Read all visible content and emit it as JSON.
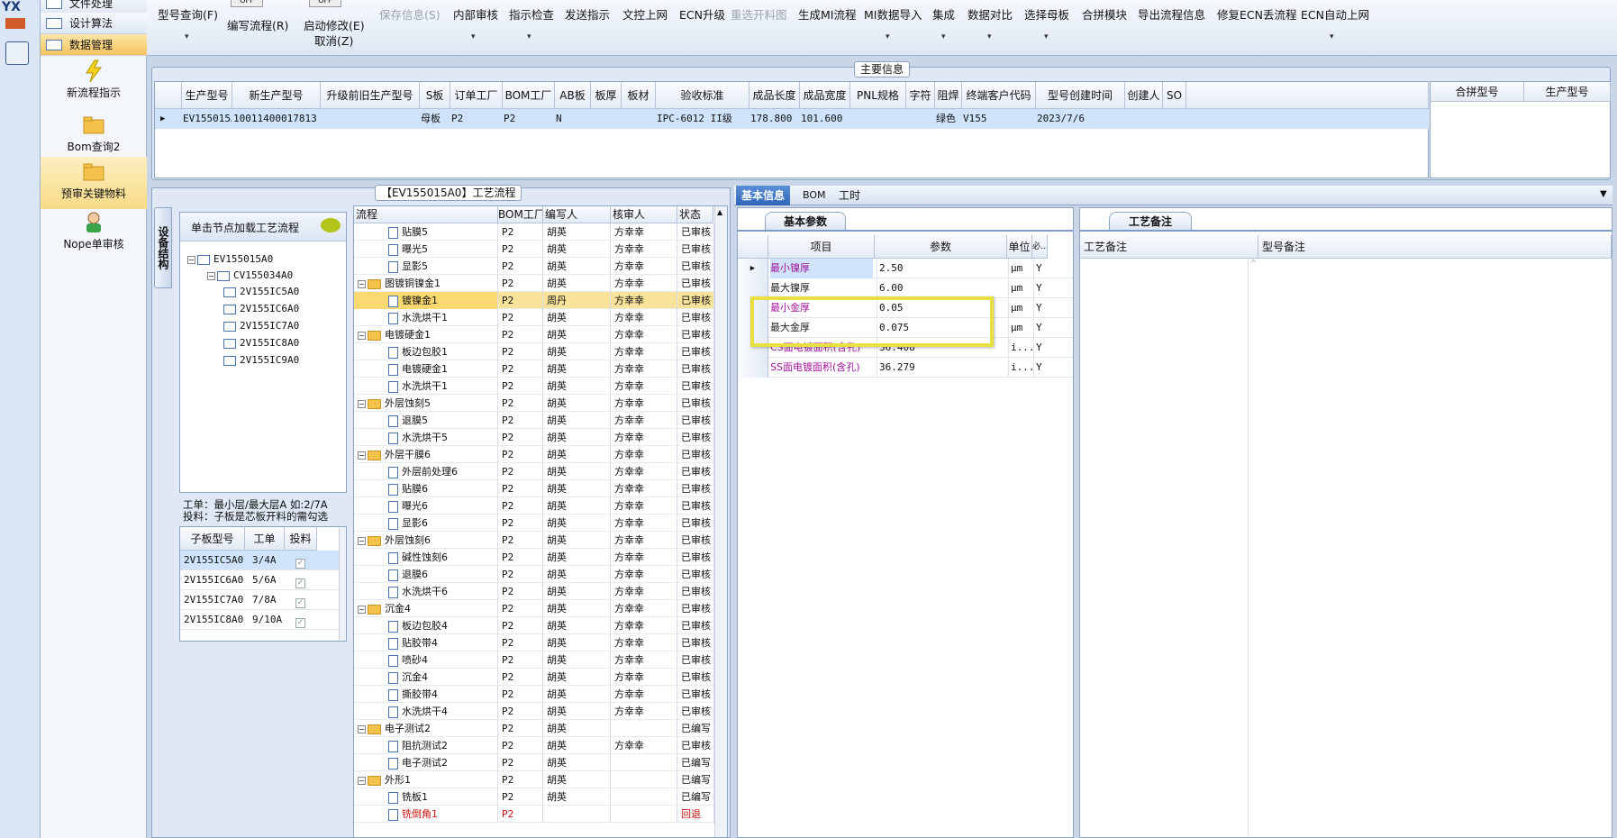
{
  "app": {
    "logo_text": "YX"
  },
  "nav": {
    "rows": [
      {
        "label": "文件处理"
      },
      {
        "label": "设计算法"
      },
      {
        "label": "数据管理"
      }
    ],
    "buttons": [
      {
        "label": "新流程指示",
        "icon": "lightning-icon"
      },
      {
        "label": "Bom查询2",
        "icon": "folder-icon"
      },
      {
        "label": "预审关键物料",
        "icon": "folder-icon"
      },
      {
        "label": "Nope单审核",
        "icon": "user-icon"
      }
    ]
  },
  "toolbar": {
    "items": [
      {
        "label": "型号查询(F)",
        "disabled": false
      },
      {
        "label": "编写流程(R)",
        "disabled": false
      },
      {
        "label": "启动修改(E)",
        "disabled": false
      },
      {
        "label": "取消(Z)",
        "disabled": false
      },
      {
        "label": "保存信息(S)",
        "disabled": true
      },
      {
        "label": "内部审核",
        "disabled": false
      },
      {
        "label": "指示检查",
        "disabled": false
      },
      {
        "label": "发送指示",
        "disabled": false
      },
      {
        "label": "文控上网",
        "disabled": false
      },
      {
        "label": "ECN升级",
        "disabled": false
      },
      {
        "label": "重选开料图",
        "disabled": true
      },
      {
        "label": "生成MI流程",
        "disabled": false
      },
      {
        "label": "MI数据导入",
        "disabled": false
      },
      {
        "label": "集成",
        "disabled": false
      },
      {
        "label": "数据对比",
        "disabled": false
      },
      {
        "label": "选择母板",
        "disabled": false
      },
      {
        "label": "合拼模块",
        "disabled": false
      },
      {
        "label": "导出流程信息",
        "disabled": false
      },
      {
        "label": "修复ECN丢流程",
        "disabled": false
      },
      {
        "label": "ECN自动上网",
        "disabled": false
      }
    ],
    "toggle_off": "OFF"
  },
  "main_info": {
    "title": "主要信息",
    "columns": [
      "生产型号",
      "新生产型号",
      "升级前旧生产型号",
      "S板",
      "订单工厂",
      "BOM工厂",
      "AB板",
      "板厚",
      "板材",
      "验收标准",
      "成品长度",
      "成品宽度",
      "PNL规格",
      "字符",
      "阻焊",
      "终端客户代码",
      "型号创建时间",
      "创建人",
      "SO"
    ],
    "row": [
      "EV155015A0",
      "10011400017813",
      "",
      "母板",
      "P2",
      "P2",
      "N",
      "",
      "",
      "IPC-6012 II级",
      "178.800",
      "101.600",
      "",
      "",
      "绿色",
      "V155",
      "2023/7/6",
      "",
      ""
    ],
    "side_columns": [
      "合拼型号",
      "生产型号"
    ]
  },
  "process": {
    "title": "【EV155015A0】工艺流程",
    "left_tab": "设备结构",
    "hint": "单击节点加载工艺流程",
    "tree": [
      "EV155015A0",
      "CV155034A0",
      "2V155IC5A0",
      "2V155IC6A0",
      "2V155IC7A0",
      "2V155IC8A0",
      "2V155IC9A0"
    ],
    "notes": [
      "工单：最小层/最大层A 如:2/7A",
      "投料：子板是芯板开料的需勾选"
    ],
    "sub_columns": [
      "子板型号",
      "工单",
      "投料"
    ],
    "sub_rows": [
      [
        "2V155IC5A0",
        "3/4A"
      ],
      [
        "2V155IC6A0",
        "5/6A"
      ],
      [
        "2V155IC7A0",
        "7/8A"
      ],
      [
        "2V155IC8A0",
        "9/10A"
      ]
    ],
    "flow_columns": [
      "流程",
      "BOM工厂",
      "编写人",
      "核审人",
      "状态"
    ],
    "flow_rows": [
      {
        "name": "贴膜5",
        "lvl": 2,
        "f": "P2",
        "w": "胡英",
        "r": "方幸幸",
        "s": "已审核"
      },
      {
        "name": "曝光5",
        "lvl": 2,
        "f": "P2",
        "w": "胡英",
        "r": "方幸幸",
        "s": "已审核"
      },
      {
        "name": "显影5",
        "lvl": 2,
        "f": "P2",
        "w": "胡英",
        "r": "方幸幸",
        "s": "已审核"
      },
      {
        "name": "图镀铜镍金1",
        "lvl": 1,
        "f": "P2",
        "w": "胡英",
        "r": "方幸幸",
        "s": "已审核"
      },
      {
        "name": "镀镍金1",
        "lvl": 2,
        "f": "P2",
        "w": "周丹",
        "r": "方幸幸",
        "s": "已审核",
        "sel": true
      },
      {
        "name": "水洗烘干1",
        "lvl": 2,
        "f": "P2",
        "w": "胡英",
        "r": "方幸幸",
        "s": "已审核"
      },
      {
        "name": "电镀硬金1",
        "lvl": 1,
        "f": "P2",
        "w": "胡英",
        "r": "方幸幸",
        "s": "已审核"
      },
      {
        "name": "板边包胶1",
        "lvl": 2,
        "f": "P2",
        "w": "胡英",
        "r": "方幸幸",
        "s": "已审核"
      },
      {
        "name": "电镀硬金1",
        "lvl": 2,
        "f": "P2",
        "w": "胡英",
        "r": "方幸幸",
        "s": "已审核"
      },
      {
        "name": "水洗烘干1",
        "lvl": 2,
        "f": "P2",
        "w": "胡英",
        "r": "方幸幸",
        "s": "已审核"
      },
      {
        "name": "外层蚀刻5",
        "lvl": 1,
        "f": "P2",
        "w": "胡英",
        "r": "方幸幸",
        "s": "已审核"
      },
      {
        "name": "退膜5",
        "lvl": 2,
        "f": "P2",
        "w": "胡英",
        "r": "方幸幸",
        "s": "已审核"
      },
      {
        "name": "水洗烘干5",
        "lvl": 2,
        "f": "P2",
        "w": "胡英",
        "r": "方幸幸",
        "s": "已审核"
      },
      {
        "name": "外层干膜6",
        "lvl": 1,
        "f": "P2",
        "w": "胡英",
        "r": "方幸幸",
        "s": "已审核"
      },
      {
        "name": "外层前处理6",
        "lvl": 2,
        "f": "P2",
        "w": "胡英",
        "r": "方幸幸",
        "s": "已审核"
      },
      {
        "name": "贴膜6",
        "lvl": 2,
        "f": "P2",
        "w": "胡英",
        "r": "方幸幸",
        "s": "已审核"
      },
      {
        "name": "曝光6",
        "lvl": 2,
        "f": "P2",
        "w": "胡英",
        "r": "方幸幸",
        "s": "已审核"
      },
      {
        "name": "显影6",
        "lvl": 2,
        "f": "P2",
        "w": "胡英",
        "r": "方幸幸",
        "s": "已审核"
      },
      {
        "name": "外层蚀刻6",
        "lvl": 1,
        "f": "P2",
        "w": "胡英",
        "r": "方幸幸",
        "s": "已审核"
      },
      {
        "name": "碱性蚀刻6",
        "lvl": 2,
        "f": "P2",
        "w": "胡英",
        "r": "方幸幸",
        "s": "已审核"
      },
      {
        "name": "退膜6",
        "lvl": 2,
        "f": "P2",
        "w": "胡英",
        "r": "方幸幸",
        "s": "已审核"
      },
      {
        "name": "水洗烘干6",
        "lvl": 2,
        "f": "P2",
        "w": "胡英",
        "r": "方幸幸",
        "s": "已审核"
      },
      {
        "name": "沉金4",
        "lvl": 1,
        "f": "P2",
        "w": "胡英",
        "r": "方幸幸",
        "s": "已审核"
      },
      {
        "name": "板边包胶4",
        "lvl": 2,
        "f": "P2",
        "w": "胡英",
        "r": "方幸幸",
        "s": "已审核"
      },
      {
        "name": "贴胶带4",
        "lvl": 2,
        "f": "P2",
        "w": "胡英",
        "r": "方幸幸",
        "s": "已审核"
      },
      {
        "name": "喷砂4",
        "lvl": 2,
        "f": "P2",
        "w": "胡英",
        "r": "方幸幸",
        "s": "已审核"
      },
      {
        "name": "沉金4",
        "lvl": 2,
        "f": "P2",
        "w": "胡英",
        "r": "方幸幸",
        "s": "已审核"
      },
      {
        "name": "撕胶带4",
        "lvl": 2,
        "f": "P2",
        "w": "胡英",
        "r": "方幸幸",
        "s": "已审核"
      },
      {
        "name": "水洗烘干4",
        "lvl": 2,
        "f": "P2",
        "w": "胡英",
        "r": "方幸幸",
        "s": "已审核"
      },
      {
        "name": "电子测试2",
        "lvl": 1,
        "f": "P2",
        "w": "胡英",
        "r": "",
        "s": "已编写"
      },
      {
        "name": "阻抗测试2",
        "lvl": 2,
        "f": "P2",
        "w": "胡英",
        "r": "方幸幸",
        "s": "已审核"
      },
      {
        "name": "电子测试2",
        "lvl": 2,
        "f": "P2",
        "w": "胡英",
        "r": "",
        "s": "已编写"
      },
      {
        "name": "外形1",
        "lvl": 1,
        "f": "P2",
        "w": "胡英",
        "r": "",
        "s": "已编写"
      },
      {
        "name": "铣板1",
        "lvl": 2,
        "f": "P2",
        "w": "胡英",
        "r": "",
        "s": "已编写"
      },
      {
        "name": "铣倒角1",
        "lvl": 2,
        "f": "P2",
        "w": "",
        "r": "",
        "s": "回退",
        "red": true
      }
    ]
  },
  "right": {
    "tabs": [
      "基本信息",
      "BOM",
      "工时"
    ],
    "basic_title": "基本参数",
    "basic_columns": [
      "项目",
      "参数",
      "单位",
      "必..."
    ],
    "basic_rows": [
      {
        "item": "最小镍厚",
        "val": "2.50",
        "unit": "μm",
        "req": "Y",
        "color": "#a3159e"
      },
      {
        "item": "最大镍厚",
        "val": "6.00",
        "unit": "μm",
        "req": "Y",
        "color": "#222"
      },
      {
        "item": "最小金厚",
        "val": "0.05",
        "unit": "μm",
        "req": "Y",
        "color": "#a3159e"
      },
      {
        "item": "最大金厚",
        "val": "0.075",
        "unit": "μm",
        "req": "Y",
        "color": "#222"
      },
      {
        "item": "CS面电镀面积(含孔)",
        "val": "36.408",
        "unit": "i...",
        "req": "Y",
        "color": "#a3159e"
      },
      {
        "item": "SS面电镀面积(含孔)",
        "val": "36.279",
        "unit": "i...",
        "req": "Y",
        "color": "#a3159e"
      }
    ],
    "notes_title": "工艺备注",
    "notes_columns": [
      "工艺备注",
      "型号备注"
    ]
  },
  "colors": {
    "accent": "#f5c24a",
    "highlight_box": "#e8e040",
    "selection": "#cfe3fb"
  }
}
